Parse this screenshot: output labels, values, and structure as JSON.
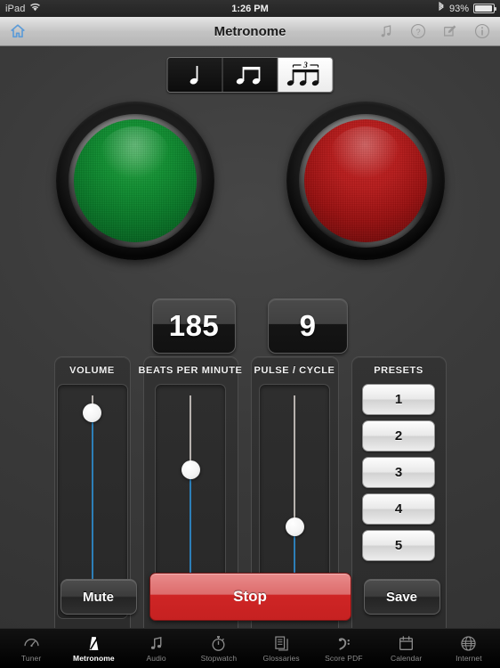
{
  "status_bar": {
    "device": "iPad",
    "wifi_icon": "wifi-icon",
    "time": "1:26 PM",
    "bluetooth_icon": "bluetooth-icon",
    "battery_percent": "93%",
    "battery_level": 93
  },
  "nav_bar": {
    "home_icon": "home-icon",
    "title": "Metronome",
    "right_icons": [
      {
        "name": "music-note-icon"
      },
      {
        "name": "help-question-icon"
      },
      {
        "name": "compose-edit-icon"
      },
      {
        "name": "info-icon"
      }
    ]
  },
  "note_selector": {
    "options": [
      {
        "name": "quarter-note",
        "label": "Quarter note",
        "selected": false
      },
      {
        "name": "eighth-note-pair",
        "label": "Eighth notes",
        "selected": false
      },
      {
        "name": "triplet",
        "label": "Triplet",
        "selected": true,
        "tuplet_number": "3"
      }
    ]
  },
  "indicators": [
    {
      "name": "beat-led-green",
      "color": "#0f8f31",
      "state": "on"
    },
    {
      "name": "beat-led-red",
      "color": "#bb1d1d",
      "state": "on"
    }
  ],
  "displays": {
    "bpm_value": "185",
    "pulse_value": "9"
  },
  "controls": {
    "volume": {
      "label": "VOLUME",
      "thumb_percent": 8
    },
    "bpm": {
      "label": "BEATS PER MINUTE",
      "thumb_percent": 35
    },
    "pulse": {
      "label": "PULSE / CYCLE",
      "thumb_percent": 62
    }
  },
  "presets": {
    "label": "PRESETS",
    "items": [
      "1",
      "2",
      "3",
      "4",
      "5"
    ]
  },
  "actions": {
    "mute_label": "Mute",
    "stop_label": "Stop",
    "save_label": "Save"
  },
  "tab_bar": {
    "tabs": [
      {
        "label": "Tuner",
        "icon": "gauge-icon",
        "active": false
      },
      {
        "label": "Metronome",
        "icon": "metronome-icon",
        "active": true
      },
      {
        "label": "Audio",
        "icon": "music-note-icon",
        "active": false
      },
      {
        "label": "Stopwatch",
        "icon": "stopwatch-icon",
        "active": false
      },
      {
        "label": "Glossaries",
        "icon": "documents-icon",
        "active": false
      },
      {
        "label": "Score PDF",
        "icon": "bass-clef-icon",
        "active": false
      },
      {
        "label": "Calendar",
        "icon": "calendar-icon",
        "active": false
      },
      {
        "label": "Internet",
        "icon": "globe-icon",
        "active": false
      }
    ]
  },
  "theme": {
    "accent_blue": "#2d7fb8",
    "stop_red": "#c62121",
    "led_green": "#0f8f31",
    "led_red": "#bb1d1d"
  }
}
